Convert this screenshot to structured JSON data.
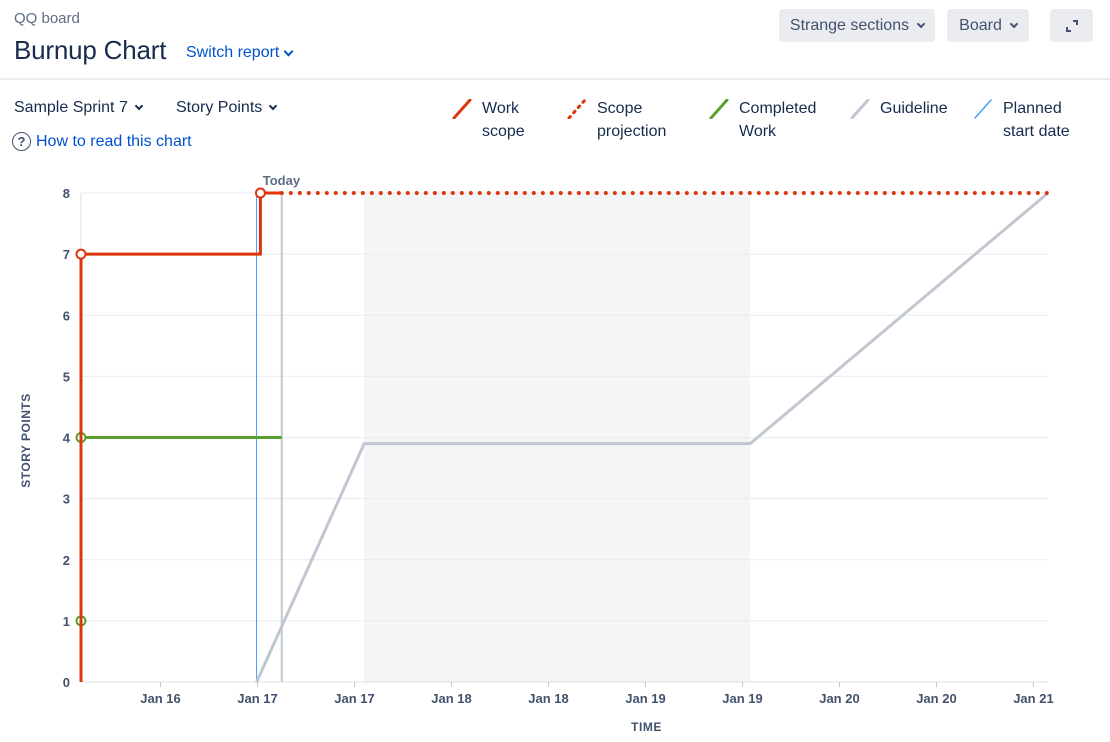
{
  "header": {
    "board_name": "QQ board",
    "title": "Burnup Chart",
    "switch_report_label": "Switch report",
    "sections_button_label": "Strange sections",
    "board_button_label": "Board",
    "expand_icon": "expand-icon"
  },
  "controls": {
    "sprint_label": "Sample Sprint 7",
    "estimate_label": "Story Points",
    "help_link_label": "How to read this chart",
    "help_icon": "question-circle-icon"
  },
  "legend": [
    {
      "label": "Work\nscope",
      "color": "#de350b",
      "style": "solid",
      "name": "legend-work-scope"
    },
    {
      "label": "Scope\nprojection",
      "color": "#de350b",
      "style": "dotted",
      "name": "legend-scope-projection"
    },
    {
      "label": "Completed\nWork",
      "color": "#5aa02c",
      "style": "solid",
      "name": "legend-completed-work"
    },
    {
      "label": "Guideline",
      "color": "#c1c7d0",
      "style": "solid",
      "name": "legend-guideline"
    },
    {
      "label": "Planned\nstart date",
      "color": "#4c9aff",
      "style": "thin",
      "name": "legend-planned-start-date"
    }
  ],
  "chart_data": {
    "type": "line",
    "title": "",
    "xlabel": "TIME",
    "ylabel": "STORY POINTS",
    "ylim": [
      0,
      8
    ],
    "yticks": [
      0,
      1,
      2,
      3,
      4,
      5,
      6,
      7,
      8
    ],
    "x_tick_labels": [
      "Jan 16",
      "Jan 17",
      "Jan 17",
      "Jan 18",
      "Jan 18",
      "Jan 19",
      "Jan 19",
      "Jan 20",
      "Jan 20",
      "Jan 21"
    ],
    "x_tick_positions": [
      1,
      2,
      3,
      4,
      5,
      6,
      7,
      8,
      9,
      10
    ],
    "xlim": [
      0.18,
      10.15
    ],
    "today_label": "Today",
    "today_x": 2.25,
    "planned_start_x": 1.99,
    "non_working_span": [
      3.1,
      7.08
    ],
    "grid": true,
    "legend_position": "top-right",
    "colors": {
      "work_scope": "#de350b",
      "completed": "#5aa02c",
      "guideline": "#c1c7d0",
      "planned_start": "#4c9aff",
      "non_working": "#f4f5f7"
    },
    "series": [
      {
        "name": "Work scope",
        "style": "step",
        "points": [
          [
            0.18,
            0
          ],
          [
            0.18,
            7
          ],
          [
            2.03,
            7
          ],
          [
            2.03,
            8
          ],
          [
            2.25,
            8
          ]
        ],
        "markers": [
          [
            0.18,
            7
          ],
          [
            2.03,
            8
          ]
        ]
      },
      {
        "name": "Scope projection",
        "style": "dotted",
        "points": [
          [
            2.25,
            8
          ],
          [
            10.15,
            8
          ]
        ],
        "markers": []
      },
      {
        "name": "Completed Work",
        "style": "step",
        "points": [
          [
            0.18,
            0
          ],
          [
            0.18,
            4
          ],
          [
            2.25,
            4
          ]
        ],
        "markers": [
          [
            0.18,
            1
          ],
          [
            0.18,
            4
          ]
        ]
      },
      {
        "name": "Guideline",
        "style": "line",
        "points": [
          [
            1.99,
            0
          ],
          [
            3.1,
            3.9
          ],
          [
            7.08,
            3.9
          ],
          [
            10.15,
            8
          ]
        ],
        "markers": []
      }
    ]
  }
}
